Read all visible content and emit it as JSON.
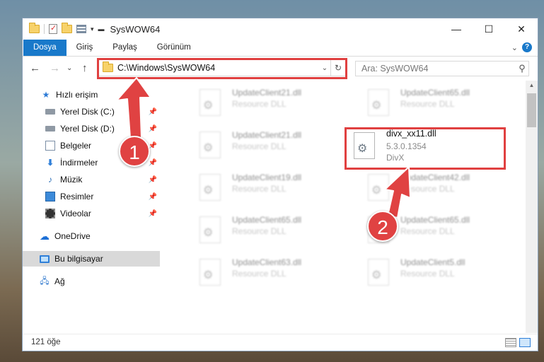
{
  "window": {
    "title": "SysWOW64",
    "controls": {
      "minimize": "—",
      "maximize": "☐",
      "close": "✕"
    }
  },
  "ribbon": {
    "tabs": [
      "Dosya",
      "Giriş",
      "Paylaş",
      "Görünüm"
    ],
    "active_tab": "Dosya",
    "accent_color": "#1979ca"
  },
  "navigation": {
    "address": "C:\\Windows\\SysWOW64",
    "search_placeholder": "Ara: SysWOW64"
  },
  "sidebar": {
    "items": [
      {
        "label": "Hızlı erişim",
        "icon": "star-icon"
      },
      {
        "label": "Yerel Disk (C:)",
        "icon": "disk-icon",
        "pinned": true
      },
      {
        "label": "Yerel Disk (D:)",
        "icon": "disk-icon",
        "pinned": true
      },
      {
        "label": "Belgeler",
        "icon": "document-icon",
        "pinned": true
      },
      {
        "label": "İndirmeler",
        "icon": "download-icon",
        "pinned": true
      },
      {
        "label": "Müzik",
        "icon": "music-icon",
        "pinned": true
      },
      {
        "label": "Resimler",
        "icon": "pictures-icon",
        "pinned": true
      },
      {
        "label": "Videolar",
        "icon": "videos-icon",
        "pinned": true
      },
      {
        "label": "OneDrive",
        "icon": "cloud-icon"
      },
      {
        "label": "Bu bilgisayar",
        "icon": "computer-icon",
        "selected": true
      },
      {
        "label": "Ağ",
        "icon": "network-icon"
      }
    ]
  },
  "files": [
    {
      "name": "UpdateClient21.dll",
      "desc": "Resource DLL"
    },
    {
      "name": "UpdateClient65.dll",
      "desc": "Resource DLL"
    },
    {
      "name": "UpdateClient21.dll",
      "desc": "Resource DLL"
    },
    {
      "name": "UpdateClient19.dll",
      "desc": "Resource DLL"
    },
    {
      "name": "UpdateClient42.dll",
      "desc": "Resource DLL"
    },
    {
      "name": "UpdateClient65.dll",
      "desc": "Resource DLL"
    },
    {
      "name": "UpdateClient65.dll",
      "desc": "Resource DLL"
    },
    {
      "name": "UpdateClient63.dll",
      "desc": "Resource DLL"
    },
    {
      "name": "UpdateClient5.dll",
      "desc": "Resource DLL"
    }
  ],
  "highlighted_file": {
    "name": "divx_xx11.dll",
    "version": "5.3.0.1354",
    "company": "DivX"
  },
  "status": {
    "item_count": "121 öğe"
  },
  "annotations": {
    "step1": "1",
    "step2": "2",
    "color": "#e04040"
  }
}
